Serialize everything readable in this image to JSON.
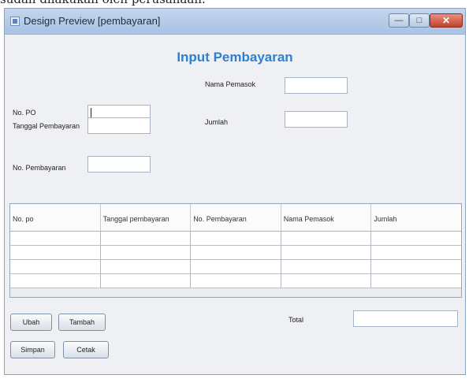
{
  "caption": "sudah dilakukan oleh perusahaan.",
  "window": {
    "title": "Design Preview [pembayaran]",
    "controls": {
      "minimize": "—",
      "maximize": "□",
      "close": "✕"
    }
  },
  "form": {
    "heading": "Input Pembayaran",
    "no_po_label": "No. PO",
    "tanggal_label": "Tanggal Pembayaran",
    "no_pembayaran_label": "No. Pembayaran",
    "nama_pemasok_label": "Nama Pemasok",
    "jumlah_label": "Jumlah"
  },
  "table": {
    "columns": [
      "No. po",
      "Tanggal pembayaran",
      "No. Pembayaran",
      "Nama Pemasok",
      "Jumlah"
    ],
    "rows": 4
  },
  "buttons": {
    "ubah": "Ubah",
    "tambah": "Tambah",
    "simpan": "Simpan",
    "cetak": "Cetak"
  },
  "total_label": "Total",
  "icons": {
    "app": "window-app-icon"
  }
}
